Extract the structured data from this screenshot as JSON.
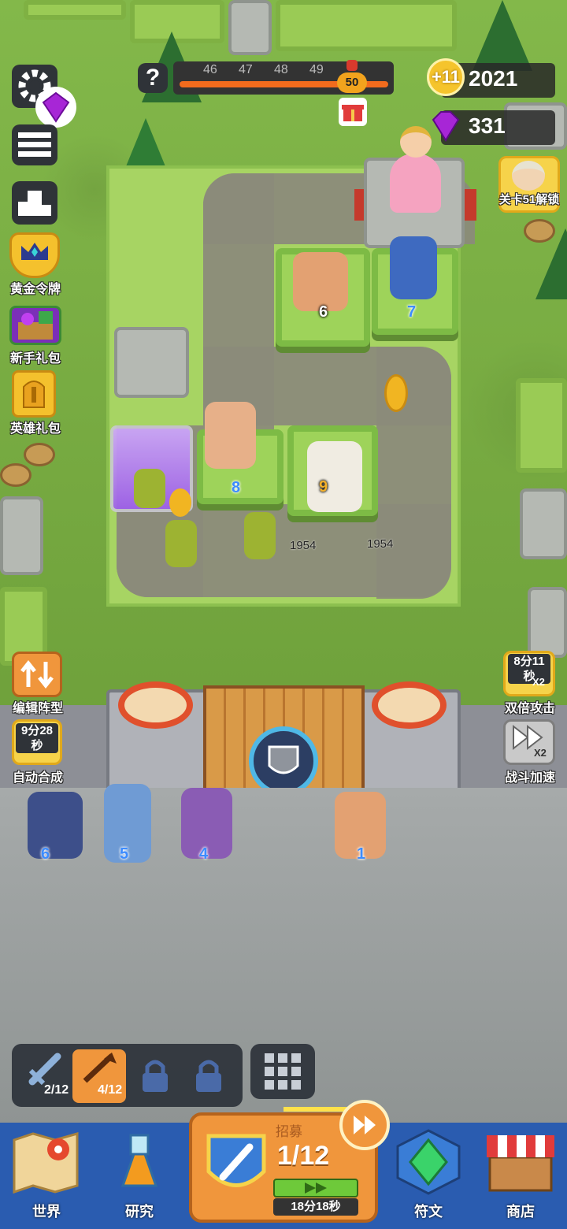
{
  "progress": {
    "waves": [
      "46",
      "47",
      "48",
      "49"
    ],
    "boss_wave": "50",
    "help_label": "?"
  },
  "currency": {
    "gold_bonus": "+11",
    "gold": "2021",
    "gems": "331"
  },
  "left_menu": {
    "gold_pass": "黄金令牌",
    "starter_pack": "新手礼包",
    "hero_pack": "英雄礼包",
    "edit_formation": "编辑阵型",
    "auto_merge_timer": "9分28秒",
    "auto_merge": "自动合成"
  },
  "right_menu": {
    "unlock_level": "关卡51解锁",
    "double_attack_timer": "8分11秒",
    "double_attack_x2": "X2",
    "double_attack": "双倍攻击",
    "speed_x2": "X2",
    "battle_speed": "战斗加速"
  },
  "battlefield": {
    "heroes_on_field": [
      "6",
      "7",
      "8",
      "9"
    ],
    "damage_numbers": [
      "1954",
      "1954"
    ]
  },
  "bench": {
    "heroes": [
      "6",
      "5",
      "4",
      "1"
    ]
  },
  "slots": {
    "sword_count": "2/12",
    "bow_count": "4/12"
  },
  "recruit": {
    "label": "招募",
    "count": "1/12",
    "timer": "18分18秒"
  },
  "nav": {
    "world": "世界",
    "research": "研究",
    "runes": "符文",
    "shop": "商店"
  },
  "colors": {
    "progress_fill": "#f26b1d",
    "gem": "#a726d6",
    "nav_bg": "#2a5cb0",
    "recruit_bg": "#f0963c",
    "hero_number": "#3d8cff"
  }
}
